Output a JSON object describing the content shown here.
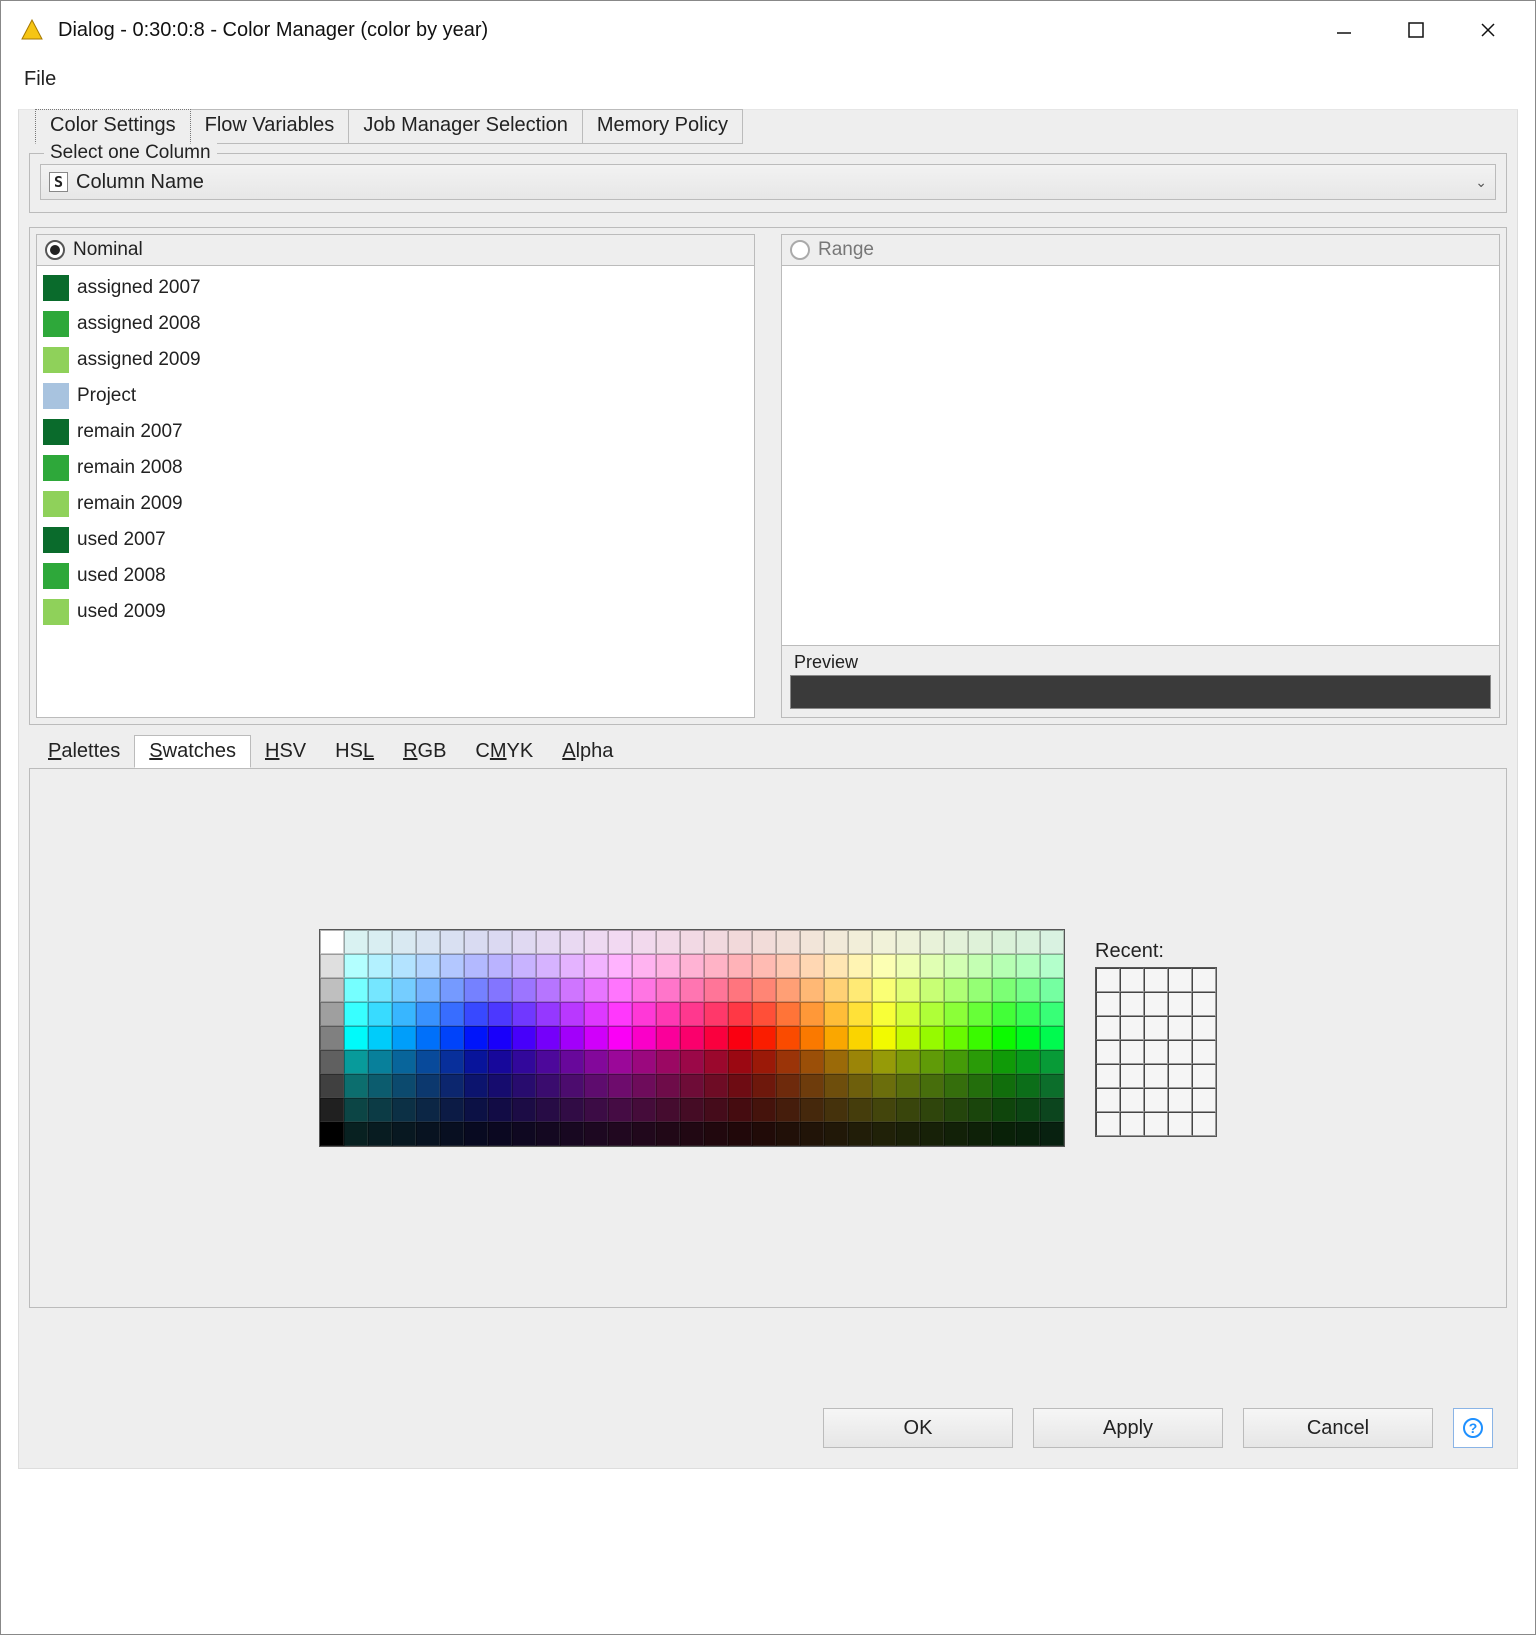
{
  "title": "Dialog - 0:30:0:8 - Color Manager (color by year)",
  "menu": {
    "file": "File"
  },
  "tabs": [
    "Color Settings",
    "Flow Variables",
    "Job Manager Selection",
    "Memory Policy"
  ],
  "active_tab": 0,
  "column_group": {
    "label": "Select one Column",
    "badge": "S",
    "selected": "Column Name"
  },
  "nominal": {
    "label": "Nominal",
    "selected": true,
    "items": [
      {
        "label": "assigned 2007",
        "color": "#0a6b2c"
      },
      {
        "label": "assigned 2008",
        "color": "#2ea83a"
      },
      {
        "label": "assigned 2009",
        "color": "#8fd15a"
      },
      {
        "label": "Project",
        "color": "#a8c3df"
      },
      {
        "label": "remain 2007",
        "color": "#0a6b2c"
      },
      {
        "label": "remain 2008",
        "color": "#2ea83a"
      },
      {
        "label": "remain 2009",
        "color": "#8fd15a"
      },
      {
        "label": "used 2007",
        "color": "#0a6b2c"
      },
      {
        "label": "used 2008",
        "color": "#2ea83a"
      },
      {
        "label": "used 2009",
        "color": "#8fd15a"
      }
    ]
  },
  "range": {
    "label": "Range",
    "selected": false
  },
  "preview": {
    "label": "Preview",
    "color": "#3a3a3a"
  },
  "cc_tabs": [
    "Palettes",
    "Swatches",
    "HSV",
    "HSL",
    "RGB",
    "CMYK",
    "Alpha"
  ],
  "cc_tabs_underline": [
    "P",
    "S",
    "H",
    "L",
    "R",
    "M",
    "A"
  ],
  "cc_active": 1,
  "recent_label": "Recent:",
  "buttons": {
    "ok": "OK",
    "apply": "Apply",
    "cancel": "Cancel"
  }
}
